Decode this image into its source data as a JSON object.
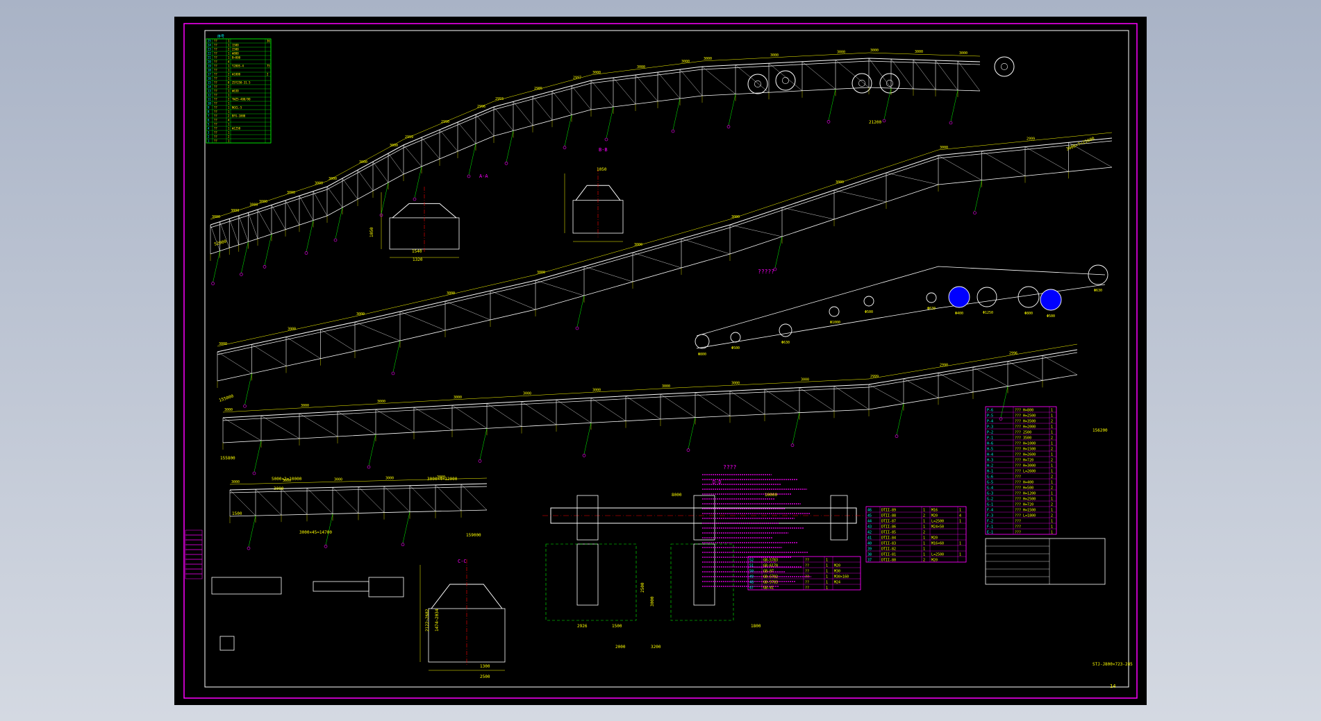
{
  "colors": {
    "background": "#000000",
    "viewport": "#b8c0cf",
    "frame": "#ff00ff",
    "structure": "#ffffff",
    "dimension": "#ffff00",
    "leader": "#00ff00",
    "centerline": "#ff0000",
    "pulley_fill": "#0000ff",
    "table_line": "#00ff00",
    "cyan": "#00ffff"
  },
  "drawing": {
    "title_block": {
      "code": "STJ-J800×723-285",
      "sheet": "14"
    },
    "section_labels": {
      "section_a": "A-A",
      "section_b": "B-B",
      "section_c": "C-C",
      "section_d": "D-D"
    },
    "overall_lengths": {
      "view1_total": "52000",
      "view1_right": "21200",
      "view2_total": "155000",
      "view2_slope": "3000×7=21000",
      "view3_total": "155800",
      "view3_right": "156200",
      "view4_total": "159000",
      "view4_a": "5000×2=10000",
      "view4_b": "3000×4=12000",
      "view4_c": "3000×45=14700",
      "view4_d": "1500",
      "view4_e": "3000"
    },
    "spacing_labels": [
      "3000",
      "3000",
      "3000",
      "3000",
      "3000",
      "3000",
      "3000",
      "3000",
      "3000",
      "2999",
      "2990",
      "2996",
      "2993",
      "2985",
      "2997"
    ],
    "pulley_labels": [
      "Φ800",
      "Φ500",
      "Φ630",
      "Φ1000",
      "Φ500",
      "Φ630",
      "Φ400",
      "Φ1250"
    ],
    "drive_labels": {
      "width_a": "1500",
      "width_b": "1800",
      "depth_a": "3200",
      "depth_b": "2000",
      "height_a": "2500",
      "height_b": "3000",
      "drive_len": "8000",
      "spacing": "10000",
      "dim_a": "2926"
    },
    "section_dims": {
      "w_a": "1540",
      "w_b": "1320",
      "w_c": "1050",
      "h_a": "1050",
      "h_b": "2122~2682",
      "w_d": "1300",
      "w_e": "2500",
      "h_c": "1474~2034"
    },
    "notes_title": "????",
    "scheme_title": "?????"
  },
  "bom_left": {
    "header": "序号",
    "rows": [
      [
        "25",
        "??",
        "1",
        "",
        "36"
      ],
      [
        "24",
        "??",
        "1",
        "1500",
        ""
      ],
      [
        "23",
        "??",
        "2",
        "2500",
        ""
      ],
      [
        "22",
        "??",
        "1",
        "Φ800",
        ""
      ],
      [
        "21",
        "??",
        "1",
        "B=800",
        ""
      ],
      [
        "20",
        "??",
        "4",
        "",
        ""
      ],
      [
        "19",
        "??",
        "1",
        "Y280S-4",
        "75"
      ],
      [
        "18",
        "??",
        "1",
        "",
        ""
      ],
      [
        "17",
        "??",
        "2",
        "Φ1000",
        "2"
      ],
      [
        "16",
        "??",
        "1",
        "",
        ""
      ],
      [
        "15",
        "??",
        "8",
        "ZSY250-31.5",
        ""
      ],
      [
        "14",
        "??",
        "2",
        "",
        ""
      ],
      [
        "13",
        "??",
        "1",
        "Φ630",
        ""
      ],
      [
        "12",
        "??",
        "1",
        "",
        ""
      ],
      [
        "11",
        "??",
        "2",
        "YWZ5-400/90",
        ""
      ],
      [
        "10",
        "??",
        "1",
        "",
        ""
      ],
      [
        "9",
        "??",
        "1",
        "NGCL-5",
        ""
      ],
      [
        "8",
        "??",
        "1",
        "",
        ""
      ],
      [
        "7",
        "??",
        "2",
        "BFG-1000",
        ""
      ],
      [
        "6",
        "??",
        "4",
        "",
        ""
      ],
      [
        "5",
        "??",
        "1",
        "",
        ""
      ],
      [
        "4",
        "??",
        "1",
        "Φ1250",
        ""
      ],
      [
        "3",
        "??",
        "1",
        "",
        ""
      ],
      [
        "2",
        "??",
        "2",
        "",
        ""
      ],
      [
        "1",
        "??",
        "1",
        "",
        ""
      ]
    ]
  },
  "bom_right": {
    "rows": [
      [
        "P-6",
        "??? H=800",
        "1"
      ],
      [
        "P-5",
        "??? H=2500",
        "1"
      ],
      [
        "P-4",
        "??? H=3500",
        "2"
      ],
      [
        "P-3",
        "??? H=2000",
        "1"
      ],
      [
        "P-2",
        "??? 2500",
        "1"
      ],
      [
        "P-1",
        "??? 3500",
        "2"
      ],
      [
        "H-6",
        "??? H=1000",
        "1"
      ],
      [
        "H-5",
        "??? H=1500",
        "2"
      ],
      [
        "H-4",
        "??? H=2600",
        "1"
      ],
      [
        "H-3",
        "??? H=720",
        "2"
      ],
      [
        "H-2",
        "??? H=3000",
        "1"
      ],
      [
        "H-1",
        "??? L=2600",
        "1"
      ],
      [
        "G-6",
        "??? ",
        "2"
      ],
      [
        "G-5",
        "??? H=400",
        "1"
      ],
      [
        "G-4",
        "??? H=500",
        "2"
      ],
      [
        "G-3",
        "??? H=1200",
        "1"
      ],
      [
        "G-2",
        "??? H=2500",
        "1"
      ],
      [
        "G-1",
        "??? H=720",
        "2"
      ],
      [
        "F-4",
        "??? H=1500",
        "1"
      ],
      [
        "F-3",
        "??? L=1800",
        "2"
      ],
      [
        "F-2",
        "??? ",
        "1"
      ],
      [
        "F-1",
        "??? ",
        "1"
      ],
      [
        "E-1",
        "??? ",
        "1"
      ]
    ]
  },
  "bom_mid": {
    "rows": [
      [
        "46",
        "DTII-89",
        "1",
        "M16",
        "1"
      ],
      [
        "45",
        "DTII-88",
        "2",
        "M20",
        "4"
      ],
      [
        "44",
        "DTII-87",
        "1",
        "L=2500",
        "1"
      ],
      [
        "43",
        "DTII-86",
        "1",
        "M24×50",
        ""
      ],
      [
        "42",
        "DTII-85",
        "2",
        "",
        ""
      ],
      [
        "41",
        "DTII-84",
        "1",
        "M20",
        ""
      ],
      [
        "40",
        "DTII-83",
        "1",
        "M16×60",
        "1"
      ],
      [
        "39",
        "DTII-82",
        "1",
        "",
        ""
      ],
      [
        "38",
        "DTII-81",
        "1",
        "L=2500",
        "1"
      ],
      [
        "37",
        "DTII-80",
        "2",
        "M20",
        ""
      ]
    ]
  },
  "bom_low": {
    "rows": [
      [
        "52",
        "GB-5783",
        "??",
        "1"
      ],
      [
        "51",
        "GB-6170",
        "??",
        "1",
        "M20"
      ],
      [
        "50",
        "GB-97",
        "??",
        "1",
        "M30"
      ],
      [
        "49",
        "GB-5782",
        "??",
        "1",
        "M30×160"
      ],
      [
        "48",
        "GB-5783",
        "??",
        "1",
        "M24"
      ],
      [
        "47",
        "GB-41",
        "??",
        "1"
      ]
    ]
  }
}
